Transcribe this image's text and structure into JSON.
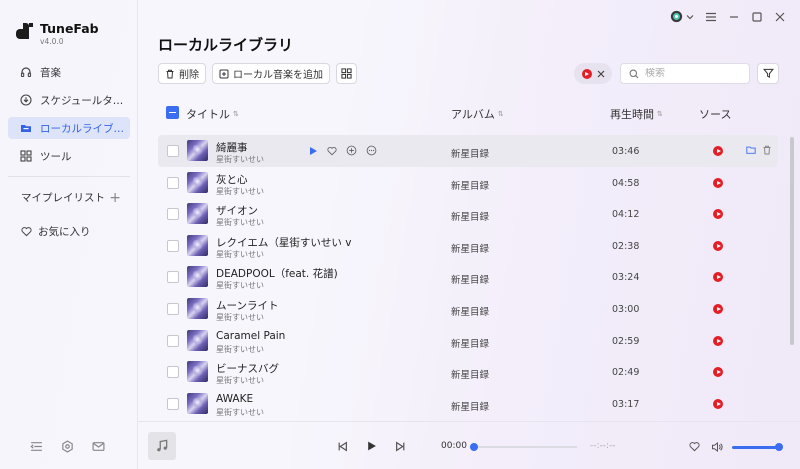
{
  "app": {
    "name": "TuneFab",
    "version": "v4.0.0"
  },
  "sidebar": {
    "items": [
      {
        "label": "音楽",
        "icon": "headphones-icon"
      },
      {
        "label": "スケジュールタ…",
        "icon": "download-icon"
      },
      {
        "label": "ローカルライブ…",
        "icon": "folder-icon"
      },
      {
        "label": "ツール",
        "icon": "grid-icon"
      }
    ],
    "playlist_label": "マイプレイリスト",
    "favorites_label": "お気に入り"
  },
  "page": {
    "title": "ローカルライブラリ"
  },
  "toolbar": {
    "delete_label": "削除",
    "add_local_label": "ローカル音楽を追加"
  },
  "search": {
    "placeholder": "検索"
  },
  "table": {
    "headers": {
      "title": "タイトル",
      "album": "アルバム",
      "duration": "再生時間",
      "source": "ソース"
    },
    "rows": [
      {
        "title": "綺麗事",
        "artist": "星街すいせい",
        "album": "新星目録",
        "duration": "03:46"
      },
      {
        "title": "灰と心",
        "artist": "星街すいせい",
        "album": "新星目録",
        "duration": "04:58"
      },
      {
        "title": "ザイオン",
        "artist": "星街すいせい",
        "album": "新星目録",
        "duration": "04:12"
      },
      {
        "title": "レクイエム（星街すいせい ver.)",
        "artist": "星街すいせい",
        "album": "新星目録",
        "duration": "02:38"
      },
      {
        "title": "DEADPOOL（feat. 花譜)",
        "artist": "星街すいせい",
        "album": "新星目録",
        "duration": "03:24"
      },
      {
        "title": "ムーンライト",
        "artist": "星街すいせい",
        "album": "新星目録",
        "duration": "03:00"
      },
      {
        "title": "Caramel Pain",
        "artist": "星街すいせい",
        "album": "新星目録",
        "duration": "02:59"
      },
      {
        "title": "ビーナスバグ",
        "artist": "星街すいせい",
        "album": "新星目録",
        "duration": "02:49"
      },
      {
        "title": "AWAKE",
        "artist": "星街すいせい",
        "album": "新星目録",
        "duration": "03:17"
      }
    ]
  },
  "player": {
    "current_time": "00:00",
    "total_time": "--:--:--",
    "progress": 0,
    "volume": 1.0
  },
  "colors": {
    "accent": "#3a6df0",
    "source_red": "#e41e26",
    "active_nav_bg": "#dde3f8"
  }
}
